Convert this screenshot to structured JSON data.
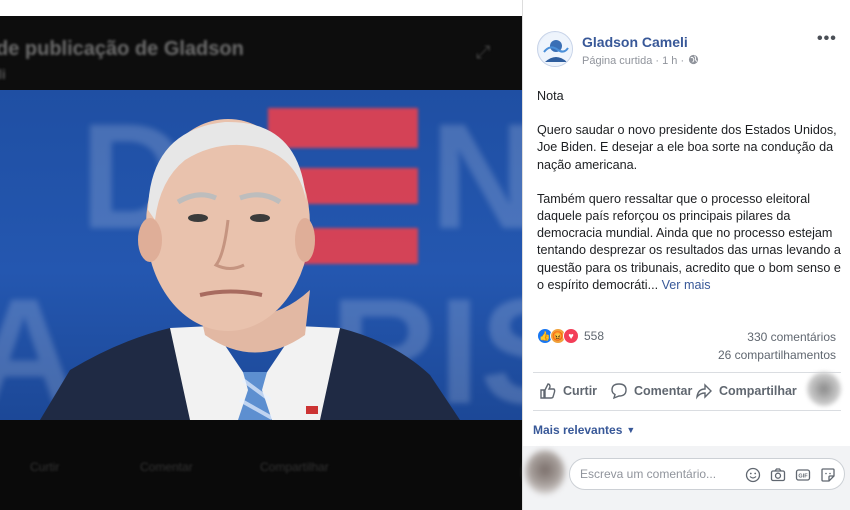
{
  "viewer": {
    "title": "de publicação de Gladson",
    "subtitle": "li",
    "footer_actions": [
      "Curtir",
      "Comentar",
      "Compartilhar"
    ]
  },
  "photo": {
    "background_letters": "IDEN ARRIS",
    "accent_color": "#e8414e",
    "bg_color": "#2457b0"
  },
  "post": {
    "page_name": "Gladson Cameli",
    "meta": "Página curtida · 1 h ·",
    "privacy_icon": "globe-icon",
    "paragraphs": [
      "Nota",
      "Quero saudar o novo presidente dos Estados Unidos, Joe Biden. E desejar a ele boa sorte na condução da nação americana.",
      "Também quero ressaltar que o processo eleitoral daquele país reforçou os principais pilares da democracia mundial. Ainda que no processo estejam tentando desprezar os resultados das urnas levando a questão para os tribunais, acredito que o bom senso e o espírito democráti..."
    ],
    "see_more": "Ver mais",
    "reaction_count": "558",
    "comments": "330 comentários",
    "shares": "26 compartilhamentos",
    "link_color": "#385898"
  },
  "actions": {
    "like": "Curtir",
    "comment": "Comentar",
    "share": "Compartilhar"
  },
  "filter": {
    "label": "Mais relevantes"
  },
  "comment_input": {
    "placeholder": "Escreva um comentário..."
  }
}
